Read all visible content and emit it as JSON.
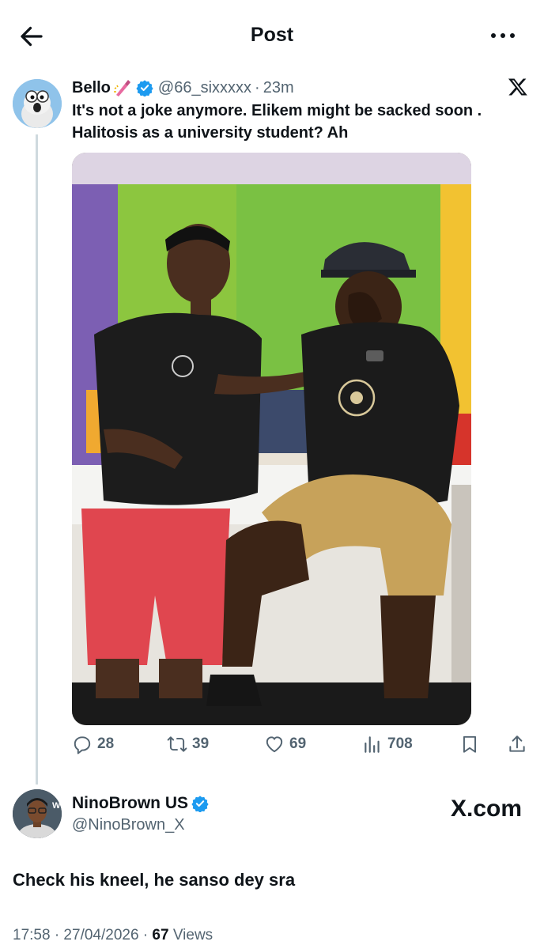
{
  "header": {
    "title": "Post",
    "back_icon": "arrow-left-icon",
    "more_icon": "more-horizontal-icon"
  },
  "quoted_post": {
    "author_name": "Bello",
    "handle": "@66_sixxxxx",
    "separator": "·",
    "time": "23m",
    "text": "It's not a joke anymore. Elikem might be sacked soon . Halitosis as a university student? Ah",
    "actions": {
      "replies": "28",
      "reposts": "39",
      "likes": "69",
      "views": "708"
    }
  },
  "reply_post": {
    "author_name": "NinoBrown US",
    "handle": "@NinoBrown_X",
    "brand": "X.com",
    "text": "Check his kneel, he sanso dey sra",
    "date_time": "17:58 · 27/04/2026 ·",
    "views_count": "67",
    "views_label": "Views"
  },
  "colors": {
    "text_primary": "#0f1419",
    "text_secondary": "#536471",
    "verified_blue": "#1d9bf0",
    "thread_line": "#cfd9de"
  }
}
